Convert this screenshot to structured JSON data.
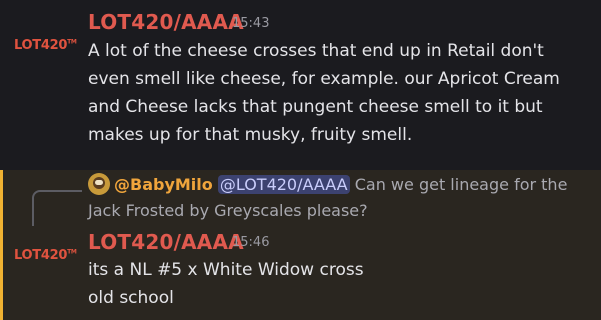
{
  "messages": [
    {
      "avatar_label": "LOT420",
      "avatar_sub": "TM",
      "author": "LOT420/AAAA",
      "time": "15:43",
      "text": "A lot of the cheese crosses that end up in Retail don't even smell like cheese, for example. our Apricot Cream and Cheese lacks that pungent cheese smell to it but makes up for that musky, fruity smell."
    },
    {
      "reply": {
        "author": "@BabyMilo",
        "mention": "@LOT420/AAAA",
        "text": "Can we get lineage for the Jack Frosted by Greyscales please?"
      },
      "avatar_label": "LOT420",
      "avatar_sub": "TM",
      "author": "LOT420/AAAA",
      "time": "15:46",
      "text": "its a NL #5 x White Widow cross",
      "followup": "old school"
    }
  ],
  "colors": {
    "background": "#1b1b1f",
    "highlight_background": "#2a2620",
    "highlight_bar": "#f0b232",
    "username": "#e05a4f",
    "mention_bg": "#3c4270",
    "reply_author": "#f0a53c"
  }
}
